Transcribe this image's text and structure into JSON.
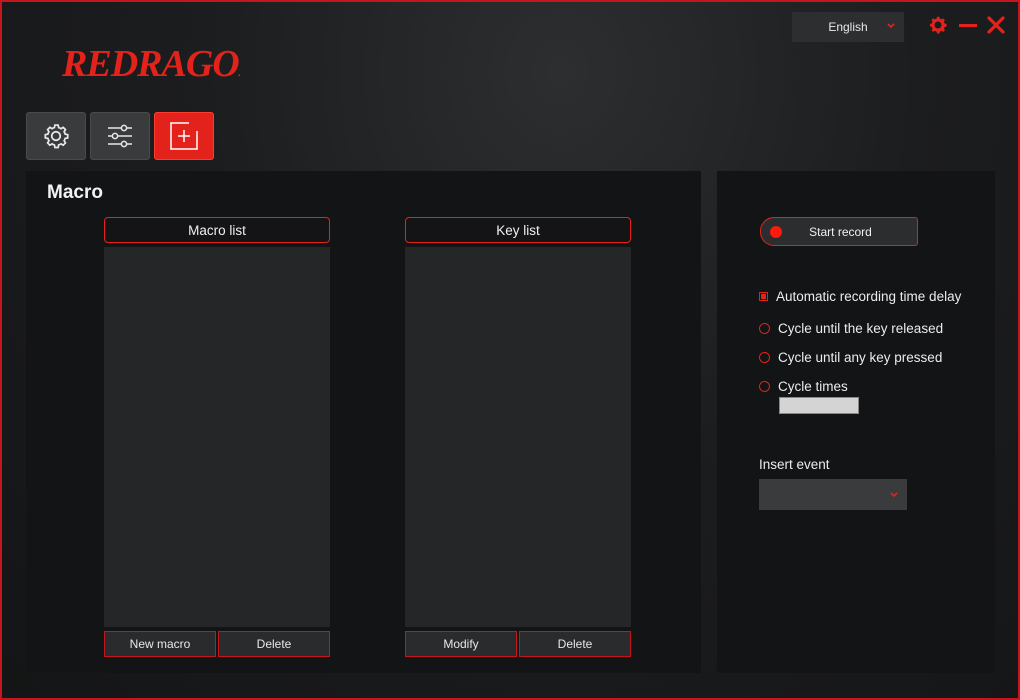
{
  "app": {
    "brand": "REDRAGON"
  },
  "header": {
    "language": "English",
    "icons": [
      "gear-icon",
      "minimize-icon",
      "close-icon"
    ]
  },
  "tabs": [
    {
      "icon": "gear-icon",
      "active": false
    },
    {
      "icon": "sliders-icon",
      "active": false
    },
    {
      "icon": "macro-plus-icon",
      "active": true
    }
  ],
  "macro": {
    "title": "Macro",
    "macro_list": {
      "header": "Macro list",
      "new_label": "New macro",
      "delete_label": "Delete"
    },
    "key_list": {
      "header": "Key list",
      "modify_label": "Modify",
      "delete_label": "Delete"
    }
  },
  "record": {
    "start_label": "Start record",
    "auto_delay_label": "Automatic recording time delay",
    "auto_delay_checked": true,
    "options": [
      {
        "label": "Cycle until the key released",
        "selected": false
      },
      {
        "label": "Cycle until any key pressed",
        "selected": false
      },
      {
        "label": "Cycle times",
        "selected": false
      }
    ],
    "cycle_times_value": "",
    "insert_event_label": "Insert event",
    "insert_event_value": ""
  },
  "colors": {
    "accent": "#e3231b",
    "panel": "#131415",
    "list": "#252627"
  }
}
